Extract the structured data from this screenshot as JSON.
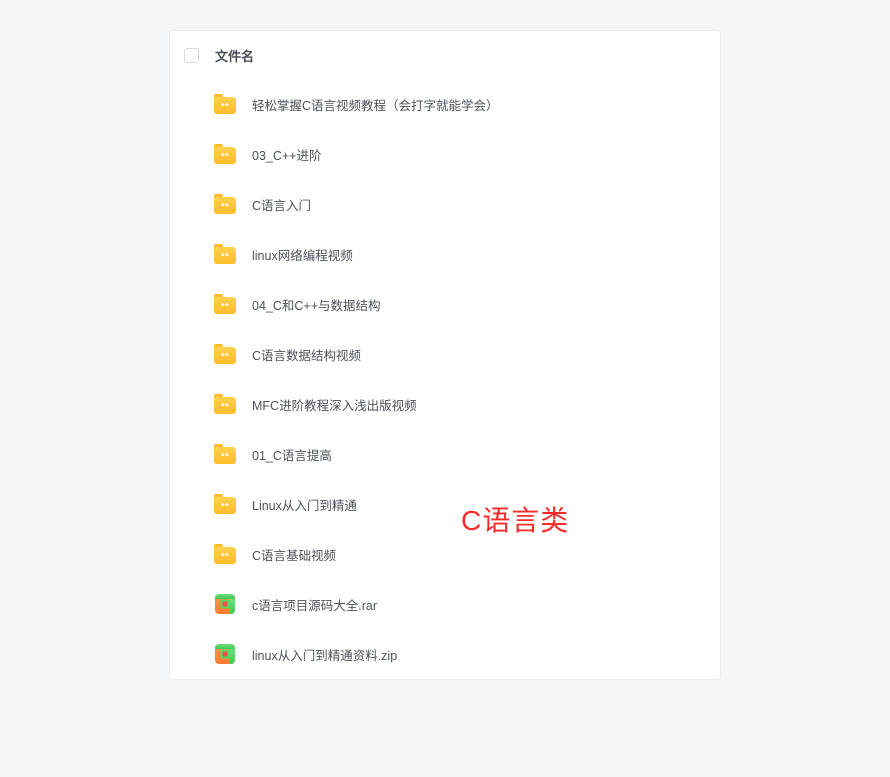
{
  "header": {
    "title": "文件名"
  },
  "files": [
    {
      "type": "folder",
      "name": "轻松掌握C语言视频教程（会打字就能学会）"
    },
    {
      "type": "folder",
      "name": "03_C++进阶"
    },
    {
      "type": "folder",
      "name": "C语言入门"
    },
    {
      "type": "folder",
      "name": "linux网络编程视频"
    },
    {
      "type": "folder",
      "name": "04_C和C++与数据结构"
    },
    {
      "type": "folder",
      "name": "C语言数据结构视频"
    },
    {
      "type": "folder",
      "name": "MFC进阶教程深入浅出版视频"
    },
    {
      "type": "folder",
      "name": "01_C语言提高"
    },
    {
      "type": "folder",
      "name": "Linux从入门到精通"
    },
    {
      "type": "folder",
      "name": "C语言基础视频"
    },
    {
      "type": "archive",
      "name": "c语言项目源码大全.rar"
    },
    {
      "type": "archive",
      "name": "linux从入门到精通资料.zip"
    }
  ],
  "overlay": {
    "label": "C语言类"
  }
}
